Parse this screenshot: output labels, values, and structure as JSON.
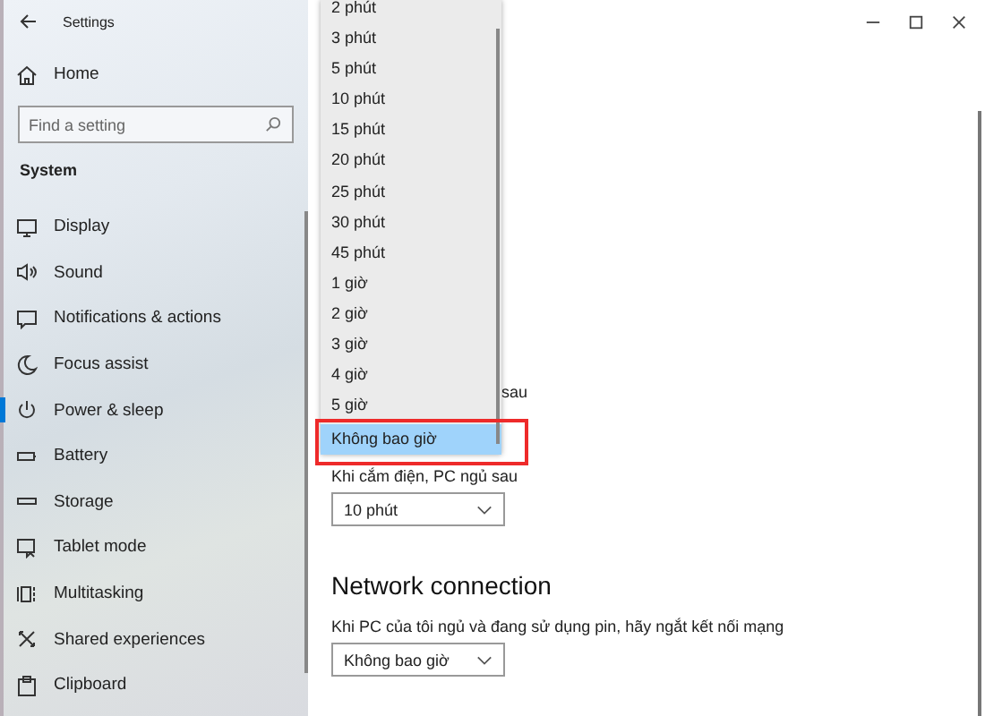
{
  "window": {
    "title": "Settings"
  },
  "sidebar": {
    "home": "Home",
    "search": {
      "placeholder": "Find a setting"
    },
    "section": "System",
    "items": [
      {
        "label": "Display",
        "selected": false
      },
      {
        "label": "Sound",
        "selected": false
      },
      {
        "label": "Notifications & actions",
        "selected": false
      },
      {
        "label": "Focus assist",
        "selected": false
      },
      {
        "label": "Power & sleep",
        "selected": true
      },
      {
        "label": "Battery",
        "selected": false
      },
      {
        "label": "Storage",
        "selected": false
      },
      {
        "label": "Tablet mode",
        "selected": false
      },
      {
        "label": "Multitasking",
        "selected": false
      },
      {
        "label": "Shared experiences",
        "selected": false
      },
      {
        "label": "Clipboard",
        "selected": false
      }
    ]
  },
  "content": {
    "covered_label": "sau",
    "plugged_label": "Khi cắm điện, PC ngủ sau",
    "plugged_value": "10 phút",
    "network_heading": "Network connection",
    "network_label": "Khi PC của tôi ngủ và đang sử dụng pin, hãy ngắt kết nối mạng",
    "network_value": "Không bao giờ"
  },
  "dropdown": {
    "options": [
      {
        "label": "2 phút",
        "selected": false
      },
      {
        "label": "3 phút",
        "selected": false
      },
      {
        "label": "5 phút",
        "selected": false
      },
      {
        "label": "10 phút",
        "selected": false
      },
      {
        "label": "15 phút",
        "selected": false
      },
      {
        "label": "20 phút",
        "selected": false
      },
      {
        "label": "25 phút",
        "selected": false
      },
      {
        "label": "30 phút",
        "selected": false
      },
      {
        "label": "45 phút",
        "selected": false
      },
      {
        "label": "1 giờ",
        "selected": false
      },
      {
        "label": "2 giờ",
        "selected": false
      },
      {
        "label": "3 giờ",
        "selected": false
      },
      {
        "label": "4 giờ",
        "selected": false
      },
      {
        "label": "5 giờ",
        "selected": false
      },
      {
        "label": "Không bao giờ",
        "selected": true
      }
    ],
    "highlighted": true
  }
}
